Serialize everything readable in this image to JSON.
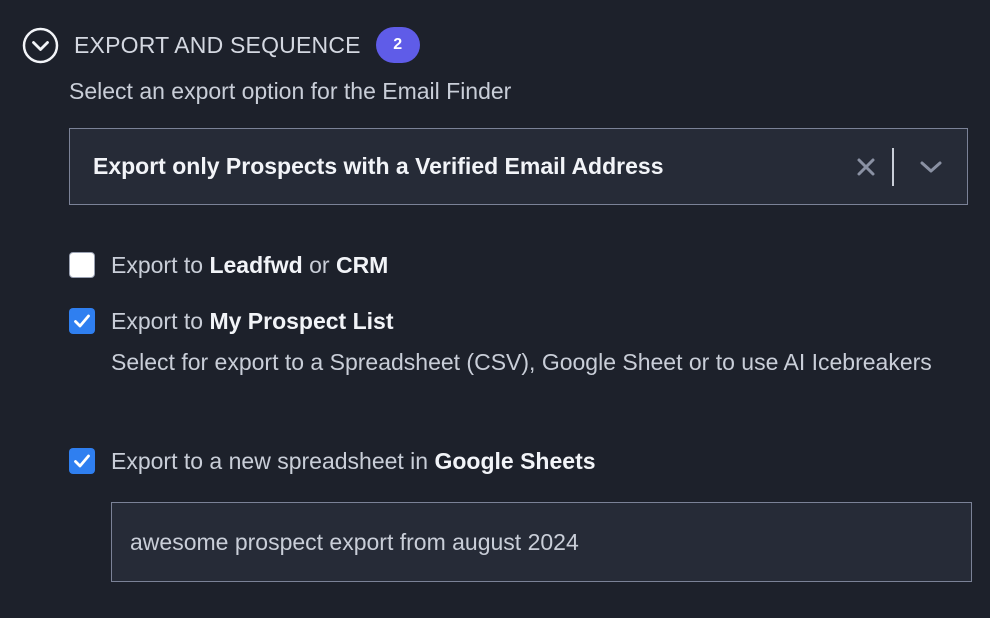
{
  "section": {
    "title": "EXPORT AND SEQUENCE",
    "badge_count": "2"
  },
  "export_option": {
    "label": "Select an export option for the Email Finder",
    "selected_value": "Export only Prospects with a Verified Email Address"
  },
  "checkbox_crm": {
    "checked": false,
    "prefix": "Export to",
    "bold1": "Leadfwd",
    "middle": "or",
    "bold2": "CRM"
  },
  "checkbox_prospect_list": {
    "checked": true,
    "prefix": "Export to",
    "bold": "My Prospect List",
    "help": "Select for export to a Spreadsheet (CSV), Google Sheet or to use AI Icebreakers"
  },
  "checkbox_google_sheets": {
    "checked": true,
    "prefix": "Export to a new spreadsheet in",
    "bold": "Google Sheets"
  },
  "spreadsheet_name": {
    "value": "awesome prospect export from august 2024"
  },
  "colors": {
    "background": "#1d212b",
    "accent_badge": "#5f5ce8",
    "checkbox_checked": "#2f7ff0"
  },
  "icons": {
    "toggle": "chevron-down-circle-icon",
    "clear": "close-icon",
    "dropdown": "chevron-down-icon",
    "checkmark": "checkmark-icon"
  }
}
